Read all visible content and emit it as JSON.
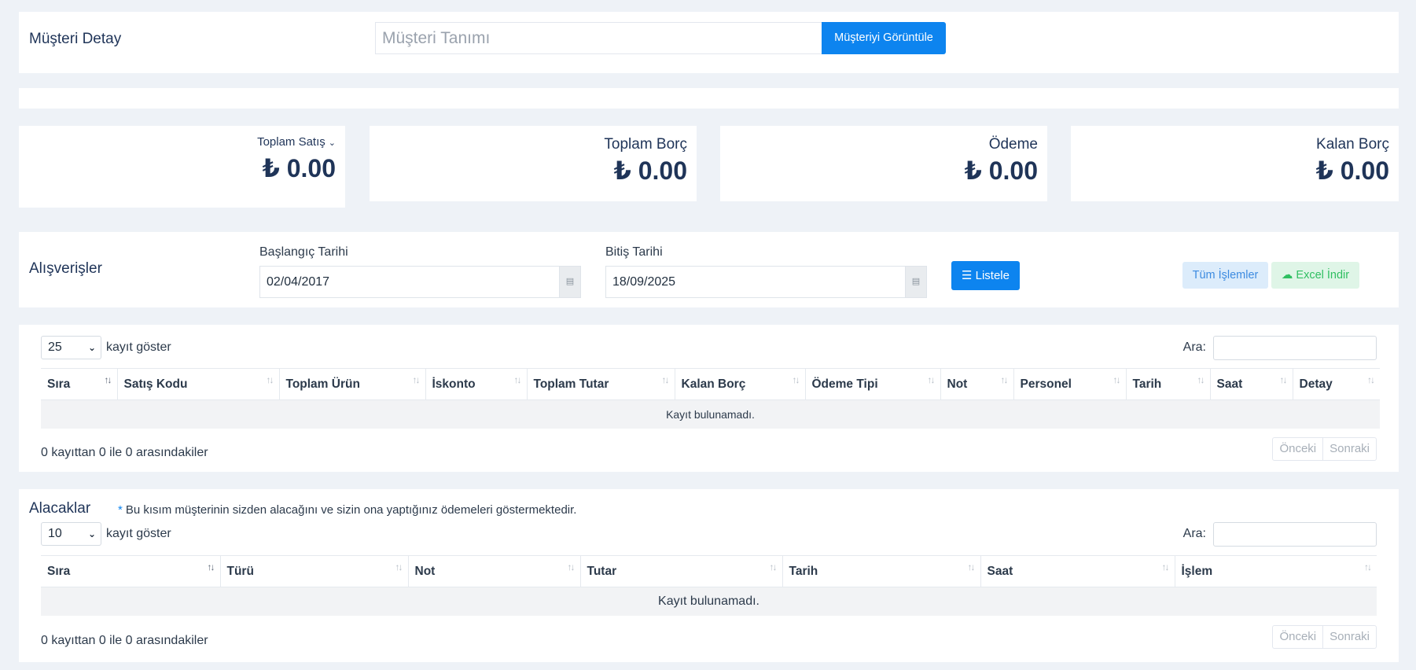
{
  "customer": {
    "title": "Müşteri Detay",
    "input_placeholder": "Müşteri Tanımı",
    "view_button": "Müşteriyi Görüntüle"
  },
  "stats": [
    {
      "label": "Toplam Satış",
      "value": "₺ 0.00",
      "has_dropdown": true
    },
    {
      "label": "Toplam Borç",
      "value": "₺ 0.00"
    },
    {
      "label": "Ödeme",
      "value": "₺ 0.00"
    },
    {
      "label": "Kalan Borç",
      "value": "₺ 0.00"
    }
  ],
  "purchases": {
    "title": "Alışverişler",
    "start_label": "Başlangıç Tarihi",
    "start_value": "02/04/2017",
    "end_label": "Bitiş Tarihi",
    "end_value": "18/09/2025",
    "list_button": "Listele",
    "all_button": "Tüm İşlemler",
    "excel_button": "Excel İndir"
  },
  "table1": {
    "page_length": "25",
    "length_label": "kayıt göster",
    "search_label": "Ara:",
    "columns": [
      "Sıra",
      "Satış Kodu",
      "Toplam Ürün",
      "İskonto",
      "Toplam Tutar",
      "Kalan Borç",
      "Ödeme Tipi",
      "Not",
      "Personel",
      "Tarih",
      "Saat",
      "Detay"
    ],
    "empty_text": "Kayıt bulunamadı.",
    "info": "0 kayıttan 0 ile 0 arasındakiler",
    "prev": "Önceki",
    "next": "Sonraki"
  },
  "receivables": {
    "title": "Alacaklar",
    "note": "Bu kısım müşterinin sizden alacağını ve sizin ona yaptığınız ödemeleri göstermektedir.",
    "page_length": "10",
    "length_label": "kayıt göster",
    "search_label": "Ara:",
    "columns": [
      "Sıra",
      "Türü",
      "Not",
      "Tutar",
      "Tarih",
      "Saat",
      "İşlem"
    ],
    "empty_text": "Kayıt bulunamadı.",
    "info": "0 kayıttan 0 ile 0 arasındakiler",
    "prev": "Önceki",
    "next": "Sonraki"
  },
  "colors": {
    "primary": "#0d84ef",
    "success": "#2fbf61",
    "background": "#eef2f7"
  }
}
